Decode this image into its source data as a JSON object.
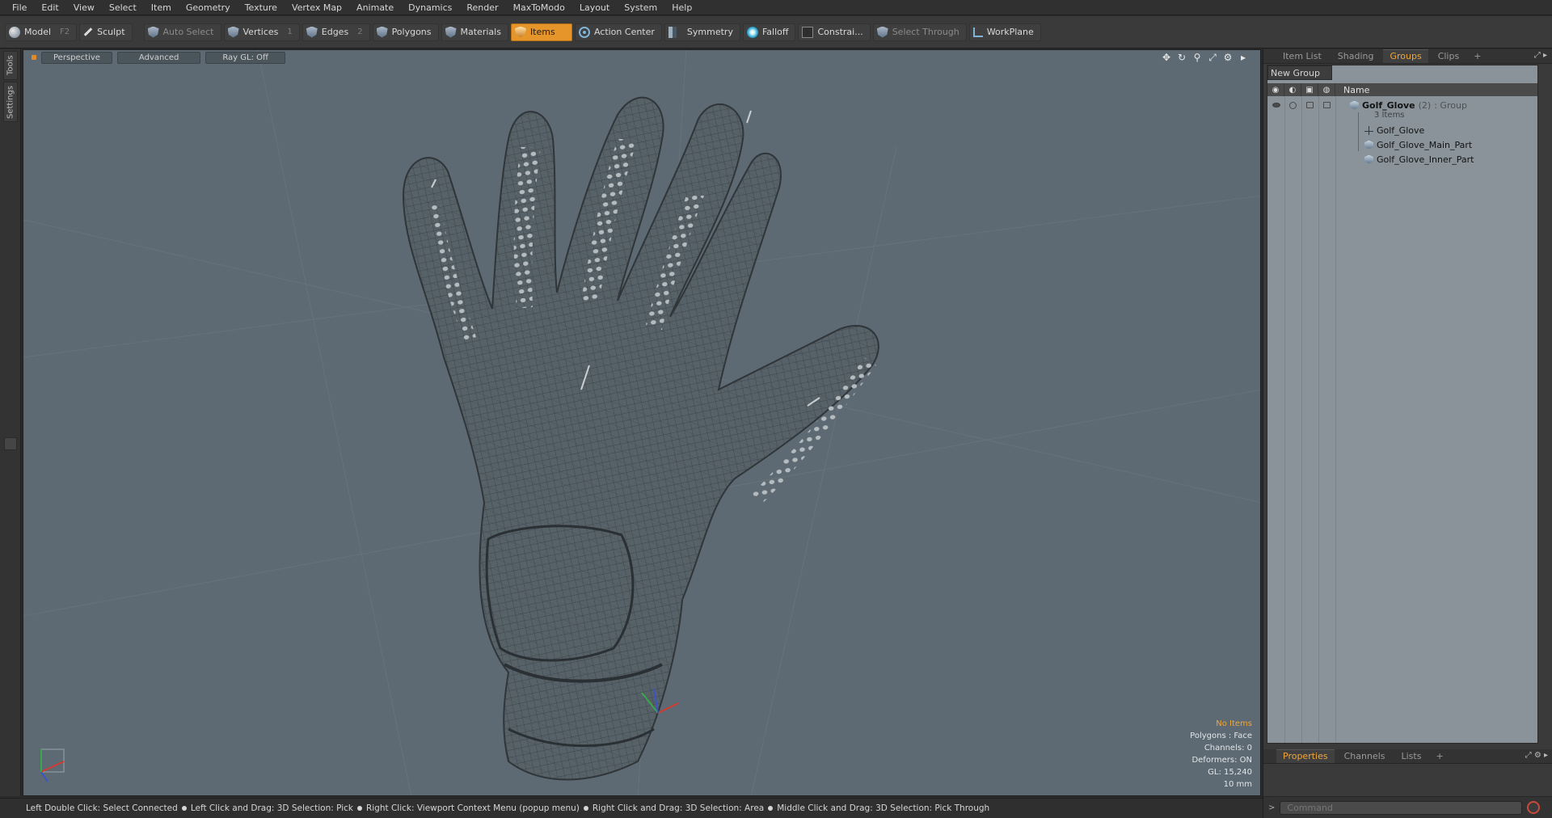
{
  "menu": [
    "File",
    "Edit",
    "View",
    "Select",
    "Item",
    "Geometry",
    "Texture",
    "Vertex Map",
    "Animate",
    "Dynamics",
    "Render",
    "MaxToModo",
    "Layout",
    "System",
    "Help"
  ],
  "toolbar": {
    "model": {
      "label": "Model",
      "key": "F2"
    },
    "sculpt": "Sculpt",
    "auto_select": "Auto Select",
    "vertices": {
      "label": "Vertices",
      "key": "1"
    },
    "edges": {
      "label": "Edges",
      "key": "2"
    },
    "polygons": "Polygons",
    "materials": "Materials",
    "items": "Items",
    "action_center": "Action Center",
    "symmetry": "Symmetry",
    "falloff": "Falloff",
    "constraints": "Constrai...",
    "select_through": "Select Through",
    "workplane": "WorkPlane"
  },
  "left_strip": {
    "tools": "Tools",
    "settings": "Settings"
  },
  "viewport": {
    "tabs": [
      "Perspective",
      "Advanced",
      "Ray GL: Off"
    ],
    "info": {
      "selection": "No Items",
      "polygons": "Polygons : Face",
      "channels": "Channels: 0",
      "deformers": "Deformers: ON",
      "gl": "GL: 15,240",
      "scale": "10 mm"
    }
  },
  "right_panel": {
    "tabs": [
      "Item List",
      "Shading",
      "Groups",
      "Clips"
    ],
    "active_tab": "Groups",
    "new_group": "New Group",
    "name_header": "Name",
    "group": {
      "name": "Golf_Glove",
      "count": "(2)",
      "type": ": Group",
      "items_label": "3 Items"
    },
    "items": [
      "Golf_Glove",
      "Golf_Glove_Main_Part",
      "Golf_Glove_Inner_Part"
    ],
    "bottom_tabs": [
      "Properties",
      "Channels",
      "Lists"
    ],
    "command_placeholder": "Command"
  },
  "status": [
    "Left Double Click: Select Connected",
    "Left Click and Drag: 3D Selection: Pick",
    "Right Click: Viewport Context Menu (popup menu)",
    "Right Click and Drag: 3D Selection: Area",
    "Middle Click and Drag: 3D Selection: Pick Through"
  ],
  "colors": {
    "accent": "#e6952a",
    "viewport_bg": "#5d6a73",
    "info_accent": "#f0a63a"
  }
}
